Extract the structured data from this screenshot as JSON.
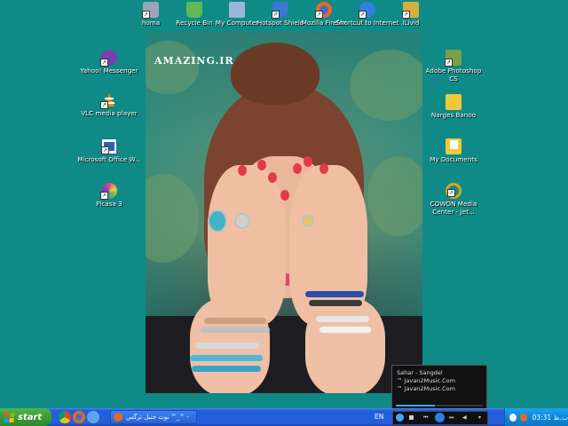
{
  "wallpaper": {
    "brand": "AMAZING.IR"
  },
  "desktop_icons_top": [
    {
      "label": "homa",
      "icon": "user-folder-icon",
      "color": "#9aa6b8"
    },
    {
      "label": "Recycle Bin",
      "icon": "recycle-bin-icon",
      "color": "#5fb85a"
    },
    {
      "label": "My Computer",
      "icon": "my-computer-icon",
      "color": "#9bb6d8"
    },
    {
      "label": "Hotspot Shield",
      "icon": "hotspot-shield-icon",
      "color": "#3a7ad0"
    },
    {
      "label": "Mozilla Firefox",
      "icon": "firefox-icon",
      "color": "#e86a1c"
    },
    {
      "label": "Shortcut to Internet",
      "icon": "internet-explorer-icon",
      "color": "#2f82e0"
    },
    {
      "label": "iLivid",
      "icon": "ilivid-icon",
      "color": "#d7b03a"
    }
  ],
  "desktop_icons_left": [
    {
      "label": "Yahoo! Messenger",
      "icon": "yahoo-messenger-icon",
      "color": "#7b3fb5"
    },
    {
      "label": "VLC media player",
      "icon": "vlc-cone-icon",
      "color": "#f08a1a"
    },
    {
      "label": "Microsoft Office W...",
      "icon": "ms-word-icon",
      "color": "#2f5fb3"
    },
    {
      "label": "Picasa 3",
      "icon": "picasa-icon",
      "color": "#d84a8a"
    }
  ],
  "desktop_icons_right": [
    {
      "label": "Adobe Photoshop CS",
      "icon": "photoshop-icon",
      "color": "#7aa04a"
    },
    {
      "label": "Narges Banoo",
      "icon": "folder-icon",
      "color": "#f0c83a"
    },
    {
      "label": "My Documents",
      "icon": "my-documents-icon",
      "color": "#f0c83a"
    },
    {
      "label": "COWON Media Center - Jet...",
      "icon": "cowon-icon",
      "color": "#e0a020"
    }
  ],
  "media_player": {
    "lines": [
      "Sahar - Sangdel",
      "™ Javan2Music.Com",
      "™ Javan2Music.Com"
    ],
    "progress": 0.45
  },
  "taskbar": {
    "start_label": "start",
    "task_title": "نوت جنبل ترگس ^_^ -",
    "language": "EN",
    "clock": "03:31 ب.ظ",
    "accent": "#245edb"
  }
}
